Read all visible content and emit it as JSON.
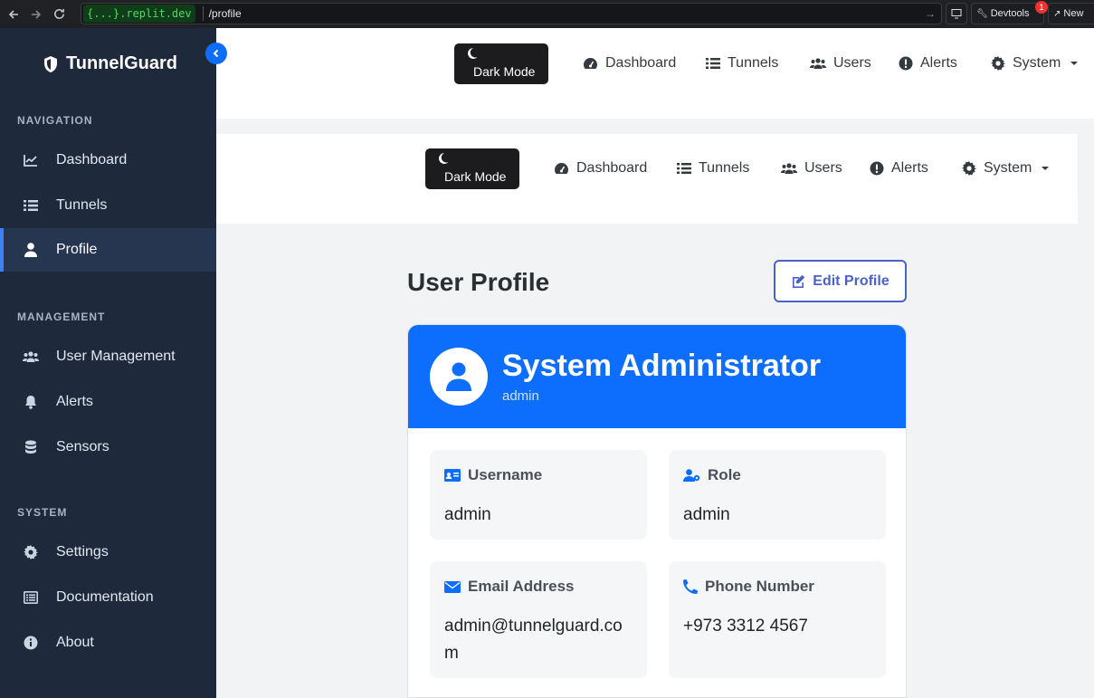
{
  "browser": {
    "domain": "{...}.replit.dev",
    "path": "/profile",
    "devtools_label": "Devtools",
    "devtools_badge": "1",
    "new_label": "New"
  },
  "sidebar": {
    "brand": "TunnelGuard",
    "sections": {
      "navigation": "NAVIGATION",
      "management": "MANAGEMENT",
      "system": "SYSTEM"
    },
    "items": [
      {
        "label": "Dashboard",
        "icon": "chart-line-icon"
      },
      {
        "label": "Tunnels",
        "icon": "list-icon"
      },
      {
        "label": "Profile",
        "icon": "user-icon",
        "active": true
      },
      {
        "label": "User Management",
        "icon": "users-icon"
      },
      {
        "label": "Alerts",
        "icon": "bell-icon"
      },
      {
        "label": "Sensors",
        "icon": "database-icon"
      },
      {
        "label": "Settings",
        "icon": "gear-icon"
      },
      {
        "label": "Documentation",
        "icon": "document-icon"
      },
      {
        "label": "About",
        "icon": "info-icon"
      }
    ]
  },
  "topnav": {
    "dark_mode": "Dark Mode",
    "links": [
      "Dashboard",
      "Tunnels",
      "Users",
      "Alerts",
      "System"
    ]
  },
  "page": {
    "title": "User Profile",
    "edit_button": "Edit Profile"
  },
  "profile": {
    "full_name": "System Administrator",
    "username_sub": "admin",
    "fields": [
      {
        "label": "Username",
        "value": "admin",
        "icon": "id-card-icon"
      },
      {
        "label": "Role",
        "value": "admin",
        "icon": "user-gear-icon"
      },
      {
        "label": "Email Address",
        "value": "admin@tunnelguard.com",
        "icon": "envelope-icon"
      },
      {
        "label": "Phone Number",
        "value": "+973 3312 4567",
        "icon": "phone-icon"
      }
    ]
  },
  "colors": {
    "sidebar_bg": "#1e293b",
    "accent": "#0d6efd",
    "edit_button": "#4a62c7"
  }
}
